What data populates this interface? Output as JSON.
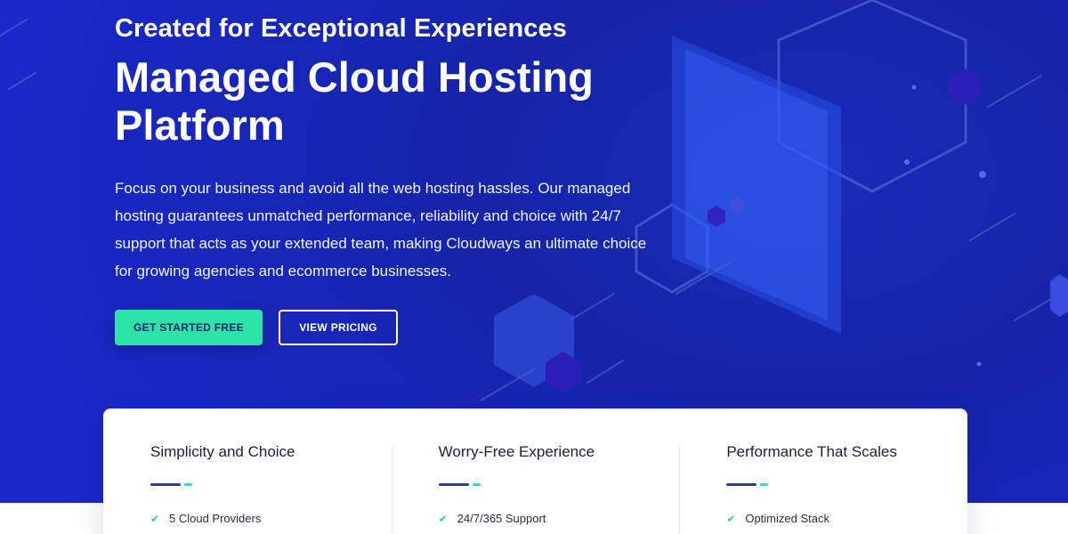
{
  "hero": {
    "eyebrow": "Created for Exceptional Experiences",
    "headline_line1": "Managed Cloud Hosting",
    "headline_line2": "Platform",
    "description": "Focus on your business and avoid all the web hosting hassles. Our managed hosting guarantees unmatched performance, reliability and choice with 24/7 support that acts as your extended team, making Cloudways an ultimate choice for growing agencies and ecommerce businesses.",
    "primary_cta": "GET STARTED FREE",
    "secondary_cta": "VIEW PRICING"
  },
  "features": [
    {
      "title": "Simplicity and Choice",
      "item": "5 Cloud Providers",
      "icon": "check-icon"
    },
    {
      "title": "Worry-Free Experience",
      "item": "24/7/365 Support",
      "icon": "check-icon"
    },
    {
      "title": "Performance That Scales",
      "item": "Optimized Stack",
      "icon": "check-icon"
    }
  ],
  "colors": {
    "hero_blue": "#1a28c8",
    "accent_green": "#2ee3a8",
    "accent_navy": "#2a3aa8",
    "text_dark": "#1b1f3b"
  }
}
